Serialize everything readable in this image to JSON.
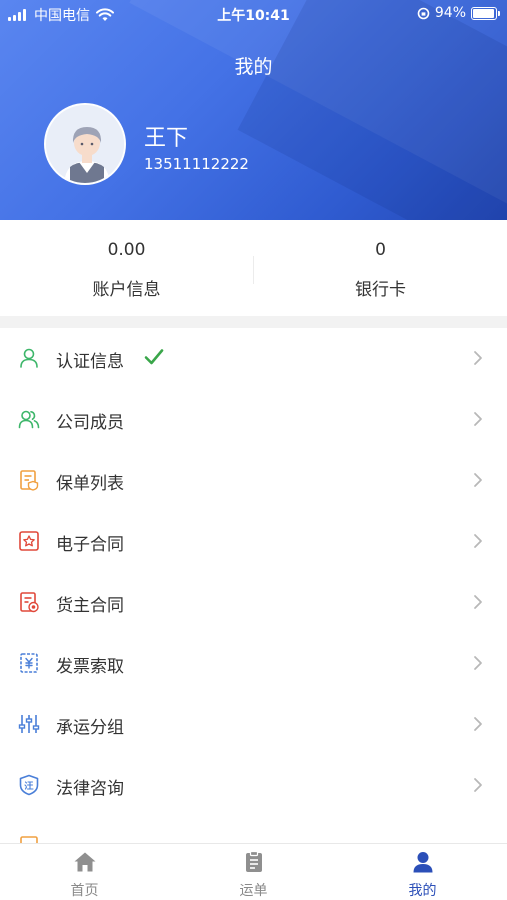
{
  "status_bar": {
    "carrier": "中国电信",
    "time": "上午10:41",
    "battery": "94%",
    "battery_level": 0.94
  },
  "header": {
    "title": "我的",
    "user": {
      "name": "王下",
      "phone": "13511112222"
    }
  },
  "stats": [
    {
      "value": "0.00",
      "label": "账户信息"
    },
    {
      "value": "0",
      "label": "银行卡"
    }
  ],
  "menu": [
    {
      "label": "认证信息",
      "icon": "user-icon",
      "verified": true
    },
    {
      "label": "公司成员",
      "icon": "members-icon"
    },
    {
      "label": "保单列表",
      "icon": "policy-list-icon"
    },
    {
      "label": "电子合同",
      "icon": "e-contract-icon"
    },
    {
      "label": "货主合同",
      "icon": "shipper-contract-icon"
    },
    {
      "label": "发票索取",
      "icon": "invoice-icon"
    },
    {
      "label": "承运分组",
      "icon": "carrier-group-icon"
    },
    {
      "label": "法律咨询",
      "icon": "legal-shield-icon"
    },
    {
      "label": "",
      "icon": "partial-row-icon"
    }
  ],
  "tabs": [
    {
      "label": "首页",
      "icon": "home-icon",
      "active": false
    },
    {
      "label": "运单",
      "icon": "waybill-icon",
      "active": false
    },
    {
      "label": "我的",
      "icon": "profile-icon",
      "active": true
    }
  ],
  "colors": {
    "header_gradient_start": "#5a86f0",
    "header_gradient_end": "#2449b6",
    "active_tab": "#2b4fb8",
    "verified_check": "#3aa64a",
    "icon_green": "#3db66a",
    "icon_orange": "#f0a040",
    "icon_red": "#e0483a",
    "icon_blue": "#4a7fd8"
  }
}
